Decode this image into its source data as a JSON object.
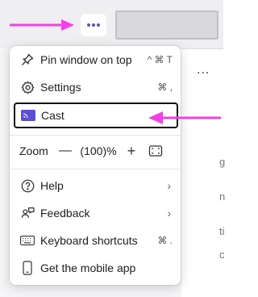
{
  "accent_color": "#5b4fd8",
  "annotation_color": "#f23fe6",
  "toolbar": {
    "more_icon": "more-horizontal-icon"
  },
  "menu": {
    "items": [
      {
        "label": "Pin window on top",
        "shortcut": "^ ⌘ T",
        "icon": "pin-icon"
      },
      {
        "label": "Settings",
        "shortcut": "⌘ ,",
        "icon": "gear-icon"
      },
      {
        "label": "Cast",
        "shortcut": "",
        "icon": "cast-icon",
        "highlighted": true
      }
    ],
    "zoom": {
      "label": "Zoom",
      "decrease": "—",
      "value": "(100)%",
      "increase": "+"
    },
    "items2": [
      {
        "label": "Help",
        "icon": "help-icon",
        "submenu": true
      },
      {
        "label": "Feedback",
        "icon": "feedback-icon",
        "submenu": true
      },
      {
        "label": "Keyboard shortcuts",
        "shortcut": "⌘ .",
        "icon": "keyboard-icon"
      },
      {
        "label": "Get the mobile app",
        "icon": "phone-icon"
      }
    ],
    "chevron": "›"
  },
  "background": {
    "dots": "...",
    "fragments": [
      "g",
      "n",
      "ti",
      "c"
    ]
  }
}
